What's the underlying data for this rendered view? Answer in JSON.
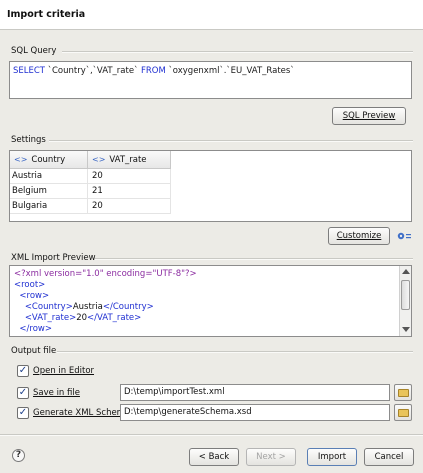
{
  "dialog": {
    "title": "Import criteria"
  },
  "sql": {
    "label": "SQL Query",
    "query": {
      "select": "SELECT",
      "columns": "`Country`,`VAT_rate`",
      "from": "FROM",
      "table": "`oxygenxml`.`EU_VAT_Rates`"
    },
    "preview_button": "SQL Preview"
  },
  "settings": {
    "label": "Settings",
    "columns": [
      "Country",
      "VAT_rate"
    ],
    "rows": [
      [
        "Austria",
        "20"
      ],
      [
        "Belgium",
        "21"
      ],
      [
        "Bulgaria",
        "20"
      ]
    ],
    "customize_button": "Customize"
  },
  "xml_preview": {
    "label": "XML Import Preview",
    "lines": [
      {
        "indent": "",
        "text": "<?xml version=\"1.0\" encoding=\"UTF-8\"?>",
        "kind": "pi"
      },
      {
        "indent": "",
        "text": "<root>",
        "kind": "tag"
      },
      {
        "indent": "  ",
        "open": "<row>",
        "kind": "tag"
      },
      {
        "indent": "    ",
        "open": "<Country>",
        "value": "Austria",
        "close": "</Country>",
        "kind": "elem"
      },
      {
        "indent": "    ",
        "open": "<VAT_rate>",
        "value": "20",
        "close": "</VAT_rate>",
        "kind": "elem"
      },
      {
        "indent": "  ",
        "open": "</row>",
        "kind": "tag"
      }
    ]
  },
  "output": {
    "label": "Output file",
    "open_in_editor": {
      "label": "Open in Editor",
      "checked": true
    },
    "save_in_file": {
      "label": "Save in file",
      "checked": true,
      "path": "D:\\temp\\importTest.xml"
    },
    "generate_schema": {
      "label": "Generate XML Schema",
      "checked": true,
      "path": "D:\\temp\\generateSchema.xsd"
    }
  },
  "footer": {
    "back": "< Back",
    "next": "Next >",
    "import": "Import",
    "cancel": "Cancel"
  },
  "icons": [
    "help-icon",
    "settings-gear-icon",
    "folder-icon",
    "xml-element-icon"
  ]
}
